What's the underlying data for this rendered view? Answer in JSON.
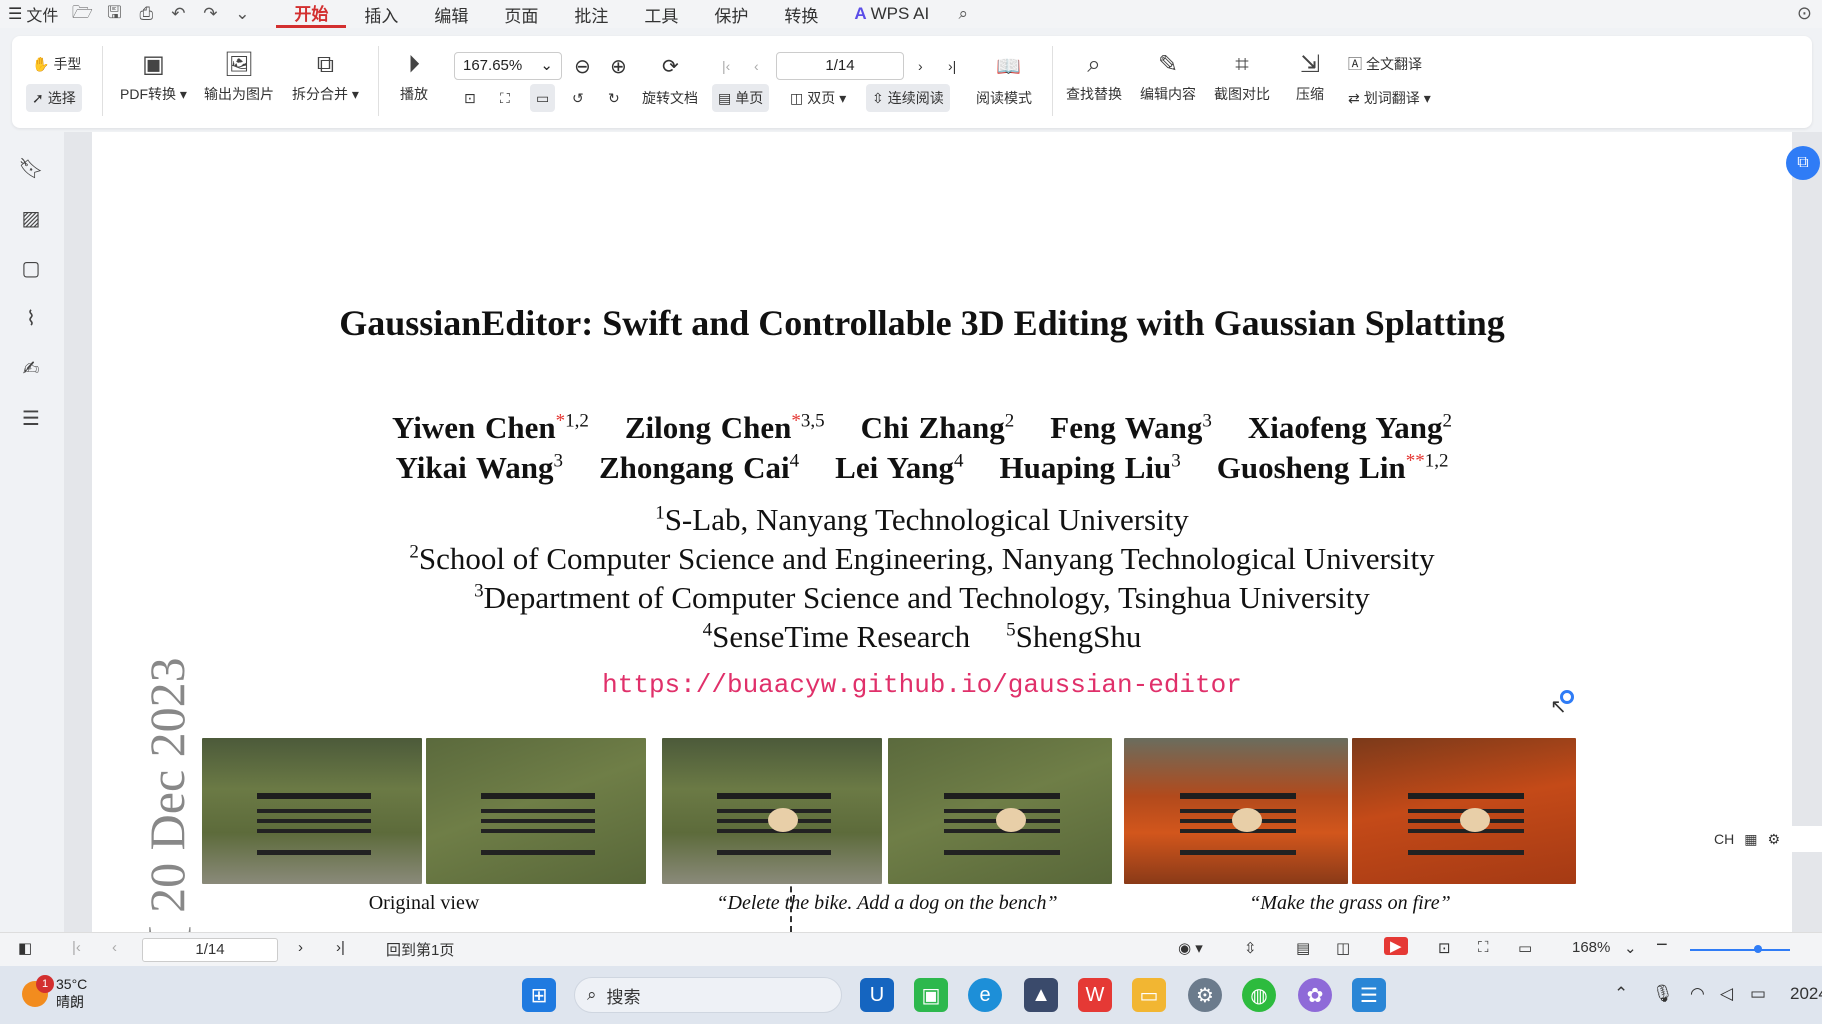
{
  "menubar": {
    "file_label": "文件",
    "tabs": [
      "开始",
      "插入",
      "编辑",
      "页面",
      "批注",
      "工具",
      "保护",
      "转换"
    ],
    "active_tab": "开始",
    "wps_ai": "WPS AI"
  },
  "ribbon": {
    "hand_tool": "手型",
    "select_tool": "选择",
    "pdf_convert": "PDF转换",
    "export_image": "输出为图片",
    "split_merge": "拆分合并",
    "play": "播放",
    "zoom_value": "167.65%",
    "page_value": "1/14",
    "rotate_doc": "旋转文档",
    "single_page": "单页",
    "double_page": "双页",
    "continuous_read": "连续阅读",
    "read_mode": "阅读模式",
    "find_replace": "查找替换",
    "edit_content": "编辑内容",
    "screenshot_compare": "截图对比",
    "compress": "压缩",
    "full_translate": "全文翻译",
    "word_translate": "划词翻译"
  },
  "paper": {
    "title": "GaussianEditor: Swift and Controllable 3D Editing with Gaussian Splatting",
    "authors_line1": [
      {
        "name": "Yiwen Chen",
        "mark": "*",
        "sup": "1,2"
      },
      {
        "name": "Zilong Chen",
        "mark": "*",
        "sup": "3,5"
      },
      {
        "name": "Chi Zhang",
        "mark": "",
        "sup": "2"
      },
      {
        "name": "Feng Wang",
        "mark": "",
        "sup": "3"
      },
      {
        "name": "Xiaofeng Yang",
        "mark": "",
        "sup": "2"
      }
    ],
    "authors_line2": [
      {
        "name": "Yikai Wang",
        "mark": "",
        "sup": "3"
      },
      {
        "name": "Zhongang Cai",
        "mark": "",
        "sup": "4"
      },
      {
        "name": "Lei Yang",
        "mark": "",
        "sup": "4"
      },
      {
        "name": "Huaping Liu",
        "mark": "",
        "sup": "3"
      },
      {
        "name": "Guosheng Lin",
        "mark": "**",
        "sup": "1,2"
      }
    ],
    "affiliations": [
      {
        "sup": "1",
        "text": "S-Lab, Nanyang Technological University"
      },
      {
        "sup": "2",
        "text": "School of Computer Science and Engineering, Nanyang Technological University"
      },
      {
        "sup": "3",
        "text": "Department of Computer Science and Technology, Tsinghua University"
      }
    ],
    "aff4_sup": "4",
    "aff4_text": "SenseTime Research",
    "aff5_sup": "5",
    "aff5_text": "ShengShu",
    "url": "https://buaacyw.github.io/gaussian-editor",
    "arxiv_side": "[ 20 Dec 2023",
    "captions": {
      "original": "Original view",
      "delete_bike": "“Delete the bike. Add a dog on the bench”",
      "grass_fire": "“Make the grass on fire”"
    }
  },
  "statusbar": {
    "page_value": "1/14",
    "back_to_first": "回到第1页",
    "zoom": "168%"
  },
  "ime": {
    "lang": "CH"
  },
  "taskbar": {
    "temperature": "35°C",
    "weather": "晴朗",
    "badge_count": "1",
    "search_placeholder": "搜索",
    "clock_partial": "2024"
  }
}
